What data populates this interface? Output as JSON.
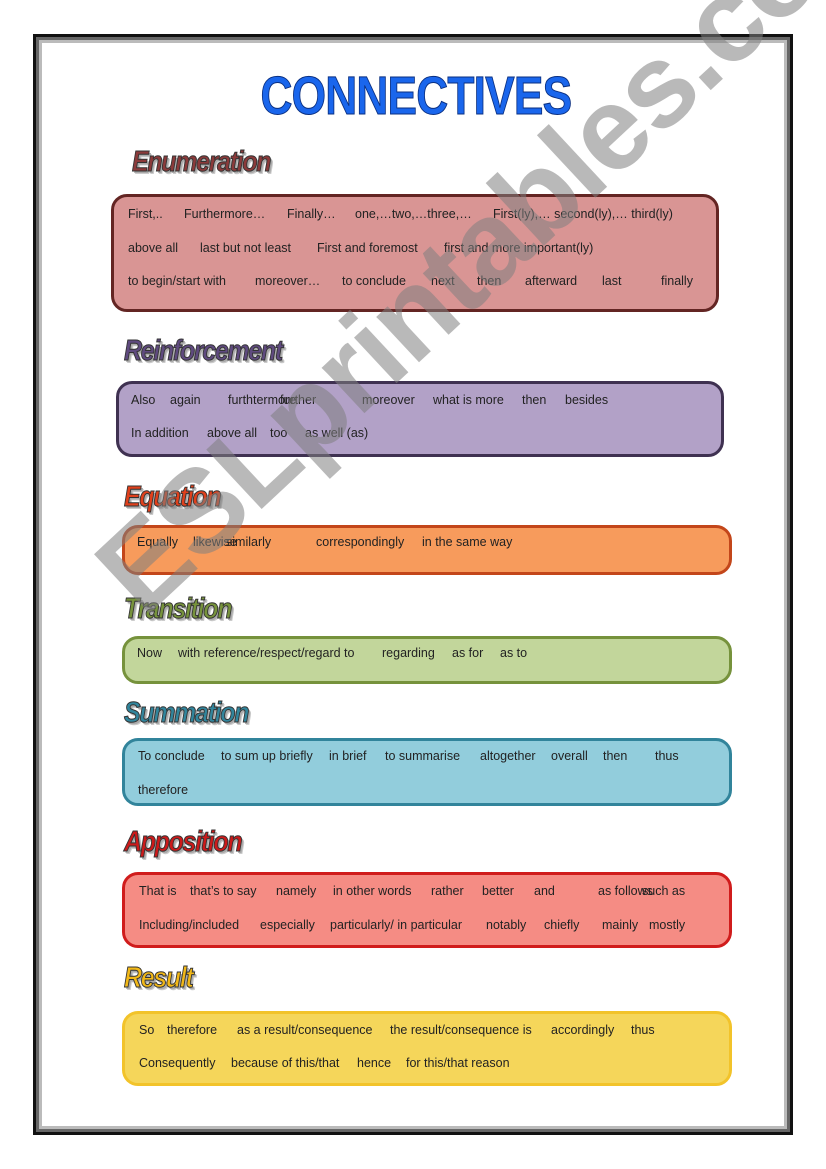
{
  "page": {
    "title": "CONNECTIVES",
    "watermark": "ESLprintables.com"
  },
  "colors": {
    "title": "#1a66ec",
    "enumeration": {
      "heading": "#8b3a3a",
      "fill": "#d99594",
      "border": "#632523"
    },
    "reinforcement": {
      "heading": "#5f4a7f",
      "fill": "#b2a1c7",
      "border": "#3f3151"
    },
    "equation": {
      "heading": "#e0401c",
      "fill": "#f79b5c",
      "border": "#c3461a"
    },
    "transition": {
      "heading": "#77933c",
      "fill": "#c2d69b",
      "border": "#76923c"
    },
    "summation": {
      "heading": "#31859c",
      "fill": "#92cddc",
      "border": "#31849b"
    },
    "apposition": {
      "heading": "#cc1a1a",
      "fill": "#f58c84",
      "border": "#d01c1c"
    },
    "result": {
      "heading": "#f2b818",
      "fill": "#f5d65a",
      "border": "#f2c32a"
    }
  },
  "sections": {
    "enumeration": {
      "heading": "Enumeration",
      "lines": [
        [
          "First,..",
          "Furthermore…",
          "Finally…",
          "one,…two,…three,…",
          "First(ly),… second(ly),… third(ly)"
        ],
        [
          "above all",
          "last but not least",
          "First and foremost",
          "first and more important(ly)"
        ],
        [
          "to begin/start with",
          "moreover…",
          "to conclude",
          "next",
          "then",
          "afterward",
          "last",
          "finally"
        ]
      ]
    },
    "reinforcement": {
      "heading": "Reinforcement",
      "lines": [
        [
          "Also",
          "again",
          "furthtermore",
          "further",
          "moreover",
          "what is more",
          "then",
          "besides"
        ],
        [
          "In addition",
          "above all",
          "too",
          "as well (as)"
        ]
      ]
    },
    "equation": {
      "heading": "Equation",
      "lines": [
        [
          "Equally",
          "likewise",
          "similarly",
          "correspondingly",
          "in the same way"
        ]
      ]
    },
    "transition": {
      "heading": "Transition",
      "lines": [
        [
          "Now",
          "with reference/respect/regard to",
          "regarding",
          "as for",
          "as to"
        ]
      ]
    },
    "summation": {
      "heading": "Summation",
      "lines": [
        [
          "To conclude",
          "to sum up briefly",
          "in brief",
          "to summarise",
          "altogether",
          "overall",
          "then",
          "thus"
        ],
        [
          "therefore"
        ]
      ]
    },
    "apposition": {
      "heading": "Apposition",
      "lines": [
        [
          "That is",
          "that’s to say",
          "namely",
          "in other words",
          "rather",
          "better",
          "and",
          "as follows",
          "such as"
        ],
        [
          "Including/included",
          "especially",
          "particularly/ in particular",
          "notably",
          "chiefly",
          "mainly",
          "mostly"
        ]
      ]
    },
    "result": {
      "heading": "Result",
      "lines": [
        [
          "So",
          "therefore",
          "as a result/consequence",
          "the result/consequence is",
          "accordingly",
          "thus"
        ],
        [
          "Consequently",
          "because of this/that",
          "hence",
          "for this/that reason"
        ]
      ]
    }
  }
}
